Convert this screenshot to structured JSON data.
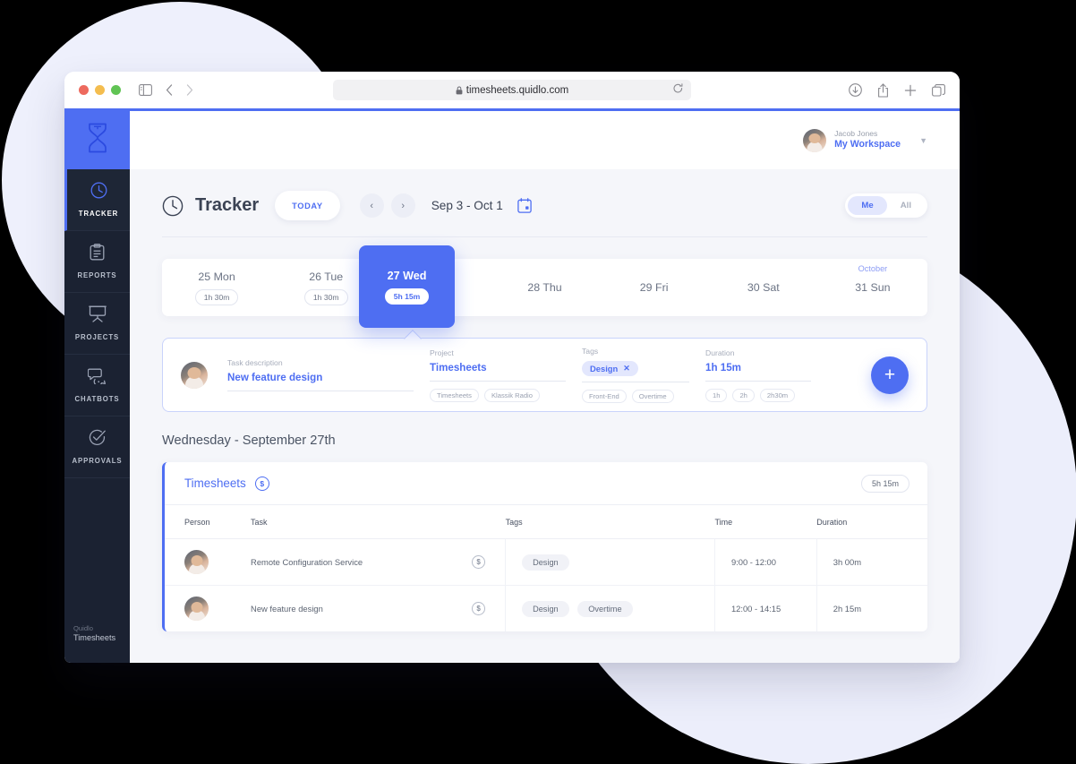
{
  "browser": {
    "url": "timesheets.quidlo.com",
    "lock_icon": "lock-icon",
    "reload_icon": "reload-icon",
    "sidebar_toggle_icon": "sidebar-toggle-icon",
    "back_icon": "back-arrow-icon",
    "forward_icon": "forward-arrow-icon",
    "shield_icon": "privacy-shield-icon",
    "download_icon": "download-icon",
    "share_icon": "share-icon",
    "new_tab_icon": "plus-icon",
    "tabs_icon": "tab-overview-icon"
  },
  "sidebar": {
    "logo_icon": "hourglass-logo-icon",
    "items": [
      {
        "label": "TRACKER",
        "icon": "clock-icon",
        "active": true
      },
      {
        "label": "REPORTS",
        "icon": "clipboard-icon",
        "active": false
      },
      {
        "label": "PROJECTS",
        "icon": "easel-icon",
        "active": false
      },
      {
        "label": "CHATBOTS",
        "icon": "chat-bubbles-icon",
        "active": false
      },
      {
        "label": "APPROVALS",
        "icon": "check-circle-icon",
        "active": false
      }
    ],
    "footer_top": "Quidlo",
    "footer_bottom": "Timesheets"
  },
  "topbar": {
    "user_name": "Jacob Jones",
    "workspace": "My Workspace",
    "caret_icon": "chevron-down-icon",
    "avatar_icon": "user-avatar"
  },
  "tracker": {
    "title": "Tracker",
    "title_icon": "clock-icon",
    "today_label": "TODAY",
    "prev_icon": "chevron-left-icon",
    "next_icon": "chevron-right-icon",
    "date_range": "Sep 3 - Oct 1",
    "calendar_icon": "calendar-icon",
    "scope_me": "Me",
    "scope_all": "All",
    "scope_selected": "Me"
  },
  "week": {
    "month_flag": "October",
    "days": [
      {
        "name": "25 Mon",
        "duration": "1h 30m",
        "selected": false
      },
      {
        "name": "26 Tue",
        "duration": "1h 30m",
        "selected": false
      },
      {
        "name": "27 Wed",
        "duration": "5h 15m",
        "selected": true
      },
      {
        "name": "28 Thu",
        "duration": "",
        "selected": false
      },
      {
        "name": "29 Fri",
        "duration": "",
        "selected": false
      },
      {
        "name": "30 Sat",
        "duration": "",
        "selected": false
      },
      {
        "name": "31 Sun",
        "duration": "",
        "selected": false
      }
    ]
  },
  "entry": {
    "avatar_icon": "user-avatar",
    "task": {
      "label": "Task description",
      "value": "New feature design",
      "placeholder": "Task description"
    },
    "project": {
      "label": "Project",
      "value": "Timesheets",
      "suggestions": [
        "Timesheets",
        "Klassik Radio"
      ]
    },
    "tags": {
      "label": "Tags",
      "selected": [
        {
          "text": "Design",
          "remove_icon": "close-icon"
        }
      ],
      "suggestions": [
        "Front-End",
        "Overtime"
      ]
    },
    "duration": {
      "label": "Duration",
      "value": "1h 15m",
      "suggestions": [
        "1h",
        "2h",
        "2h30m"
      ]
    },
    "add_icon": "plus-icon"
  },
  "day_heading": "Wednesday - September 27th",
  "timesheets": {
    "title": "Timesheets",
    "billable_icon": "dollar-circle-icon",
    "total": "5h 15m",
    "columns": [
      "Person",
      "Task",
      "Tags",
      "Time",
      "Duration"
    ],
    "rows": [
      {
        "person_icon": "user-avatar",
        "task": "Remote Configuration Service",
        "billable_icon": "dollar-circle-icon",
        "tags": [
          "Design"
        ],
        "time": "9:00 - 12:00",
        "duration": "3h 00m"
      },
      {
        "person_icon": "user-avatar",
        "task": "New feature design",
        "billable_icon": "dollar-circle-icon",
        "tags": [
          "Design",
          "Overtime"
        ],
        "time": "12:00 - 14:15",
        "duration": "2h 15m"
      }
    ]
  },
  "colors": {
    "accent": "#4e6ef2",
    "sidebar_bg": "#1b2232",
    "content_bg": "#f5f6fa",
    "bg_circle": "#eef0fc"
  }
}
